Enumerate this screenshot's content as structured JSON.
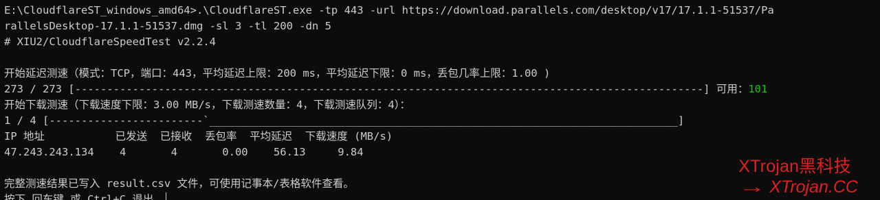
{
  "terminal": {
    "lines": [
      "E:\\CloudflareST_windows_amd64>.\\CloudflareST.exe -tp 443 -url https://download.parallels.com/desktop/v17/17.1.1-51537/Pa",
      "rallelsDesktop-17.1.1-51537.dmg -sl 3 -tl 200 -dn 5",
      "# XIU2/CloudflareSpeedTest v2.2.4",
      "",
      "开始延迟测速（模式：TCP，端口：443，平均延迟上限：200 ms，平均延迟下限：0 ms，丢包几率上限：1.00 )",
      "",
      "开始下载测速（下载速度下限：3.00 MB/s，下载测速数量：4，下载测速队列：4）：",
      "1 / 4 [------------------------`_________________________________________________________________________]",
      "IP 地址           已发送  已接收  丢包率  平均延迟  下载速度 (MB/s)",
      "47.243.243.134    4       4       0.00    56.13     9.84",
      "",
      "完整测速结果已写入 result.csv 文件，可使用记事本/表格软件查看。",
      "按下 回车键 或 Ctrl+C 退出。"
    ],
    "progress_line": {
      "text": "273 / 273 [--------------------------------------------------------------------------------------------------] 可用：",
      "available_count": "101"
    }
  },
  "colors": {
    "background": "#0c0c0c",
    "text": "#cccccc",
    "available": "#16c60c",
    "watermark": "#e02020"
  },
  "watermark": {
    "brand": "XTrojan黑科技",
    "arrow": "→",
    "site": "XTrojan.CC"
  }
}
